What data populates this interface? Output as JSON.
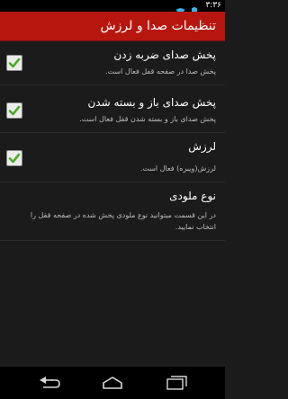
{
  "status_bar": {
    "time": "۳:۳۶",
    "icons": [
      "wifi-icon",
      "battery-icon"
    ]
  },
  "title_bar": {
    "title": "تنظیمات صدا و لرزش",
    "background_color": "#b7160f"
  },
  "settings": [
    {
      "title": "پخش صدای ضربه زدن",
      "summary": "پخش صدا در صفحه قفل فعال است.",
      "checked": true
    },
    {
      "title": "پخش صدای باز و بسته شدن",
      "summary": "پخش صدای باز و بسته شدن قفل فعال است.",
      "checked": true
    },
    {
      "title": "لرزش",
      "summary": "لرزش(ویبره) فعال است.",
      "checked": true
    },
    {
      "title": "نوع ملودی",
      "summary": "در این قسمت میتوانید نوع ملودی پخش شده در صفحه قفل را انتخاب نمایید."
    }
  ],
  "accent_color": "#4caf22",
  "nav_bar": {
    "icons": [
      "back-icon",
      "home-icon",
      "recent-apps-icon"
    ]
  }
}
